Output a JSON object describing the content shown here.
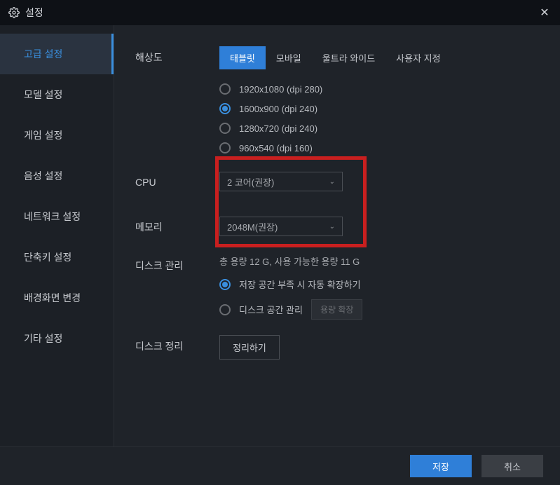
{
  "window": {
    "title": "설정",
    "close": "✕"
  },
  "sidebar": {
    "items": [
      {
        "label": "고급 설정",
        "active": true
      },
      {
        "label": "모델 설정",
        "active": false
      },
      {
        "label": "게임 설정",
        "active": false
      },
      {
        "label": "음성 설정",
        "active": false
      },
      {
        "label": "네트워크 설정",
        "active": false
      },
      {
        "label": "단축키 설정",
        "active": false
      },
      {
        "label": "배경화면 변경",
        "active": false
      },
      {
        "label": "기타 설정",
        "active": false
      }
    ]
  },
  "resolution": {
    "label": "해상도",
    "tabs": [
      {
        "label": "태블릿",
        "active": true
      },
      {
        "label": "모바일",
        "active": false
      },
      {
        "label": "울트라 와이드",
        "active": false
      },
      {
        "label": "사용자 지정",
        "active": false
      }
    ],
    "options": [
      {
        "label": "1920x1080  (dpi 280)",
        "checked": false
      },
      {
        "label": "1600x900  (dpi 240)",
        "checked": true
      },
      {
        "label": "1280x720  (dpi 240)",
        "checked": false
      },
      {
        "label": "960x540  (dpi 160)",
        "checked": false
      }
    ]
  },
  "cpu": {
    "label": "CPU",
    "value": "2 코어(권장)"
  },
  "memory": {
    "label": "메모리",
    "value": "2048M(권장)"
  },
  "disk": {
    "label": "디스크 관리",
    "info": "총 용량 12 G,  사용 가능한 용량 11 G",
    "options": [
      {
        "label": "저장 공간 부족 시 자동 확장하기",
        "checked": true
      },
      {
        "label": "디스크 공간 관리",
        "checked": false
      }
    ],
    "expand_btn": "용량 확장"
  },
  "cleanup": {
    "label": "디스크 정리",
    "button": "정리하기"
  },
  "footer": {
    "save": "저장",
    "cancel": "취소"
  }
}
